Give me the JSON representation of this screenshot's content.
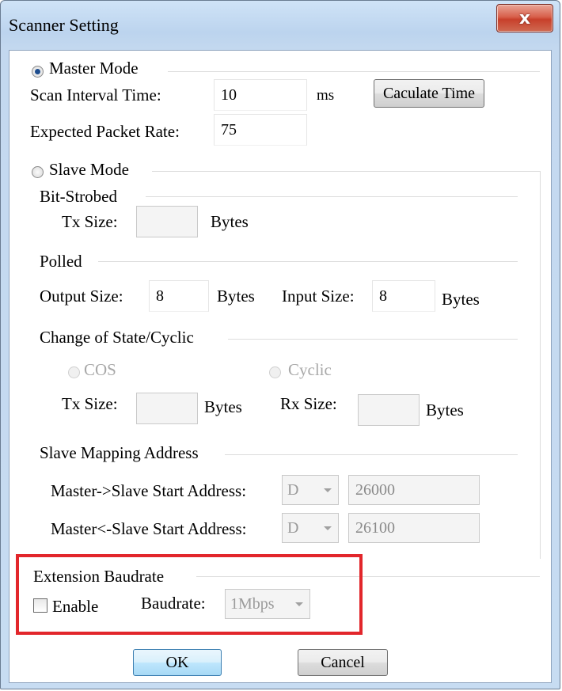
{
  "window": {
    "title": "Scanner Setting",
    "close_symbol": "x"
  },
  "master": {
    "label": "Master Mode",
    "selected": true,
    "scan_interval_label": "Scan Interval Time:",
    "scan_interval_value": "10",
    "scan_interval_unit": "ms",
    "calc_button": "Caculate Time",
    "packet_rate_label": "Expected Packet Rate:",
    "packet_rate_value": "75"
  },
  "slave": {
    "label": "Slave Mode",
    "selected": false,
    "bit_strobed": {
      "title": "Bit-Strobed",
      "tx_label": "Tx Size:",
      "tx_value": "",
      "unit": "Bytes"
    },
    "polled": {
      "title": "Polled",
      "output_label": "Output Size:",
      "output_value": "8",
      "output_unit": "Bytes",
      "input_label": "Input Size:",
      "input_value": "8",
      "input_unit": "Bytes"
    },
    "cos_cyclic": {
      "title": "Change of State/Cyclic",
      "cos_label": "COS",
      "cyclic_label": "Cyclic",
      "tx_label": "Tx Size:",
      "tx_value": "",
      "tx_unit": "Bytes",
      "rx_label": "Rx Size:",
      "rx_value": "",
      "rx_unit": "Bytes"
    },
    "mapping": {
      "title": "Slave Mapping Address",
      "m2s_label": "Master->Slave Start Address:",
      "m2s_device": "D",
      "m2s_value": "26000",
      "s2m_label": "Master<-Slave Start Address:",
      "s2m_device": "D",
      "s2m_value": "26100"
    }
  },
  "baudrate": {
    "title": "Extension Baudrate",
    "enable_label": "Enable",
    "enabled": false,
    "baudrate_label": "Baudrate:",
    "baudrate_value": "1Mbps"
  },
  "buttons": {
    "ok": "OK",
    "cancel": "Cancel"
  },
  "colors": {
    "highlight": "#e2262b",
    "close_button": "#c8402b",
    "titlebar": "#bcd4ee"
  }
}
